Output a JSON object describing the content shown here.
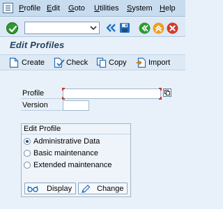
{
  "menubar": {
    "items": [
      {
        "mnemonic": "P",
        "rest": "rofile"
      },
      {
        "mnemonic": "E",
        "rest": "dit"
      },
      {
        "mnemonic": "G",
        "rest": "oto"
      },
      {
        "mnemonic": "U",
        "rest": "tilities"
      },
      {
        "mnemonic": "S",
        "rest": "ystem"
      },
      {
        "mnemonic": "H",
        "rest": "elp"
      }
    ]
  },
  "command_field": {
    "value": ""
  },
  "title": "Edit Profiles",
  "app_toolbar": {
    "create": "Create",
    "check": "Check",
    "copy": "Copy",
    "import": "Import"
  },
  "form": {
    "profile_label": "Profile",
    "profile_value": "",
    "version_label": "Version",
    "version_value": ""
  },
  "edit_profile": {
    "title": "Edit Profile",
    "options": [
      {
        "label": "Administrative Data",
        "selected": true
      },
      {
        "label": "Basic maintenance",
        "selected": false
      },
      {
        "label": "Extended maintenance",
        "selected": false
      }
    ],
    "display_button": "Display",
    "change_button": "Change"
  },
  "colors": {
    "background": "#e8f1f9",
    "title": "#23425f",
    "ok_green": "#2f9a2f",
    "nav_orange": "#f0a020",
    "cancel_red": "#d13b2b"
  }
}
